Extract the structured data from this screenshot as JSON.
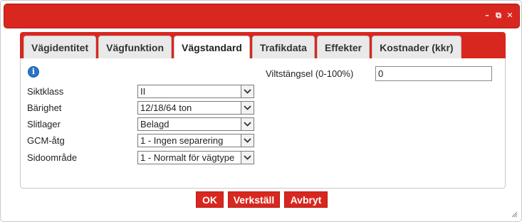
{
  "window": {
    "controls": {
      "minimize": "–",
      "restore": "⧉",
      "close": "✕"
    }
  },
  "tabs": [
    {
      "label": "Vägidentitet",
      "active": false
    },
    {
      "label": "Vägfunktion",
      "active": false
    },
    {
      "label": "Vägstandard",
      "active": true
    },
    {
      "label": "Trafikdata",
      "active": false
    },
    {
      "label": "Effekter",
      "active": false
    },
    {
      "label": "Kostnader (kkr)",
      "active": false
    }
  ],
  "form": {
    "info_icon": "info-icon",
    "fields": [
      {
        "label": "Siktklass",
        "value": "II"
      },
      {
        "label": "Bärighet",
        "value": "12/18/64 ton"
      },
      {
        "label": "Slitlager",
        "value": "Belagd"
      },
      {
        "label": "GCM-åtg",
        "value": "1 - Ingen separering"
      },
      {
        "label": "Sidoområde",
        "value": "1 - Normalt för vägtype"
      }
    ],
    "fence": {
      "label": "Viltstängsel (0-100%)",
      "value": "0"
    }
  },
  "buttons": {
    "ok": "OK",
    "apply": "Verkställ",
    "cancel": "Avbryt"
  },
  "colors": {
    "accent": "#d8271f",
    "info": "#2a74c8"
  }
}
